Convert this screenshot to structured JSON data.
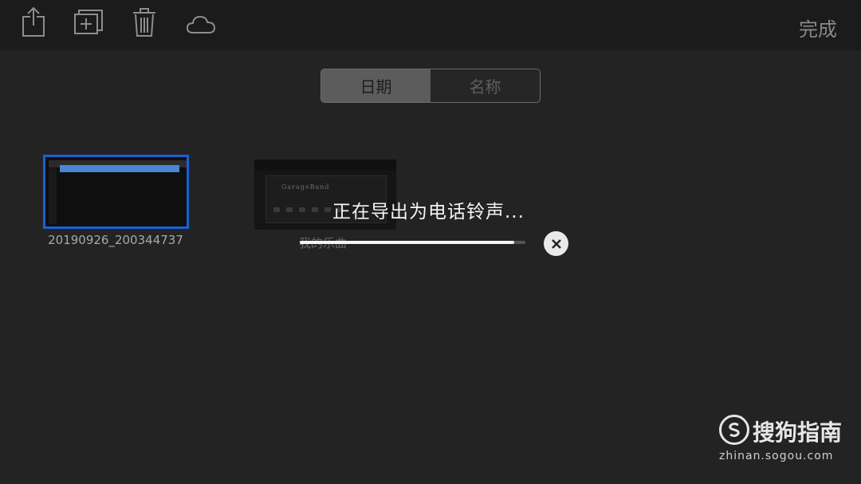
{
  "toolbar": {
    "icons": [
      "share-icon",
      "duplicate-icon",
      "trash-icon",
      "cloud-icon"
    ],
    "done_label": "完成"
  },
  "sort": {
    "options": [
      "日期",
      "名称"
    ],
    "selected": "日期"
  },
  "projects": [
    {
      "name": "20190926_200344737",
      "selected": true
    },
    {
      "name": "我的乐曲",
      "thumbnail_text": "GarageBand",
      "selected": false
    }
  ],
  "export": {
    "message": "正在导出为电话铃声...",
    "progress": 0.95,
    "cancel_icon": "close-icon"
  },
  "watermark": {
    "title": "搜狗指南",
    "url": "zhinan.sogou.com"
  },
  "colors": {
    "background": "#232323",
    "toolbar": "#1b1b1b",
    "selection_border": "#1c5fd6"
  }
}
